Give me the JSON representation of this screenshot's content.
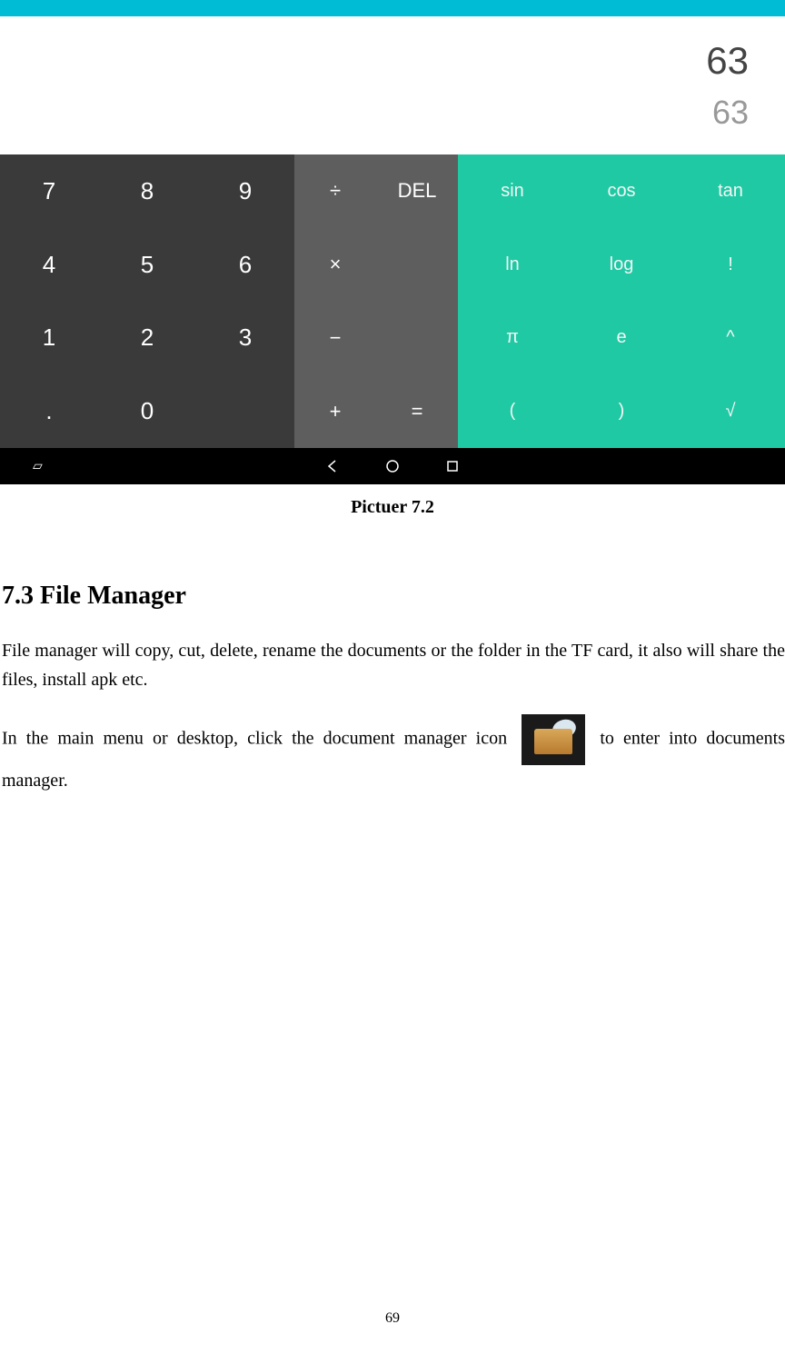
{
  "calculator": {
    "display_main": "63",
    "display_sub": "63",
    "numpad": [
      "7",
      "8",
      "9",
      "4",
      "5",
      "6",
      "1",
      "2",
      "3",
      ".",
      "0",
      ""
    ],
    "oppad": [
      "÷",
      "DEL",
      "×",
      "",
      "−",
      "",
      "+",
      "="
    ],
    "scipad": [
      "sin",
      "cos",
      "tan",
      "ln",
      "log",
      "!",
      "π",
      "e",
      "^",
      "(",
      ")",
      "√"
    ]
  },
  "caption": "Pictuer 7.2",
  "section": {
    "title": "7.3 File Manager",
    "para1": "File manager will copy, cut, delete, rename the documents or the folder in the TF card, it also will share the files, install apk etc.",
    "para2_pre": "In the main menu or desktop, click the document manager icon",
    "para2_post": "to enter into documents manager."
  },
  "page_number": "69"
}
